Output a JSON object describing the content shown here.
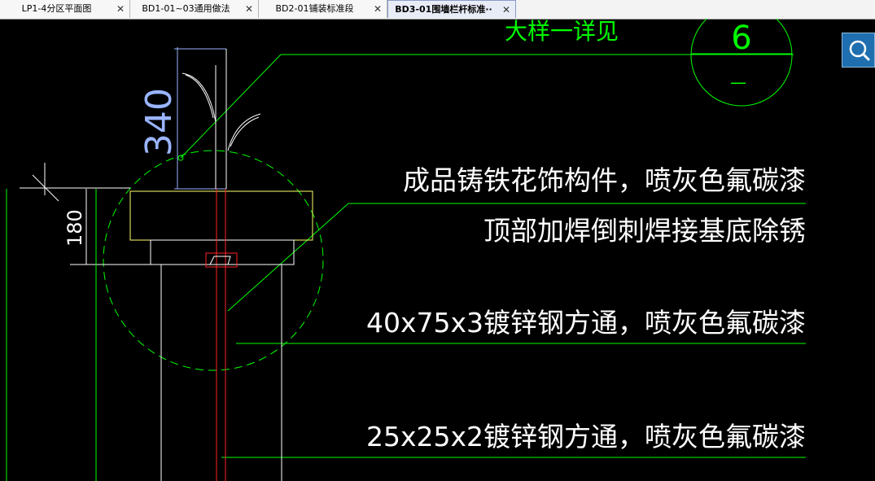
{
  "tabs": [
    {
      "label": "LP1-4分区平面图",
      "close": "✕"
    },
    {
      "label": "BD1-01~03通用做法",
      "close": "✕"
    },
    {
      "label": "BD2-01铺装标准段",
      "close": "✕"
    },
    {
      "label": "BD3-01围墙栏杆标准··",
      "close": "✕",
      "active": true
    }
  ],
  "drawing": {
    "dim_340": "340",
    "dim_180": "180",
    "top_partial_text": "大样一详见",
    "circle_number": "6",
    "circle_dash": "—",
    "note_1": "成品铸铁花饰构件，喷灰色氟碳漆",
    "note_2": "顶部加焊倒刺焊接基底除锈",
    "note_3": "40x75x3镀锌钢方通，喷灰色氟碳漆",
    "note_4": "25x25x2镀锌钢方通，喷灰色氟碳漆"
  },
  "colors": {
    "green": "#00ff00",
    "yellow": "#ffff66",
    "red": "#ff2222",
    "white": "#ffffff",
    "blue": "#9ab4ff"
  },
  "search": {
    "icon": "search-icon"
  }
}
